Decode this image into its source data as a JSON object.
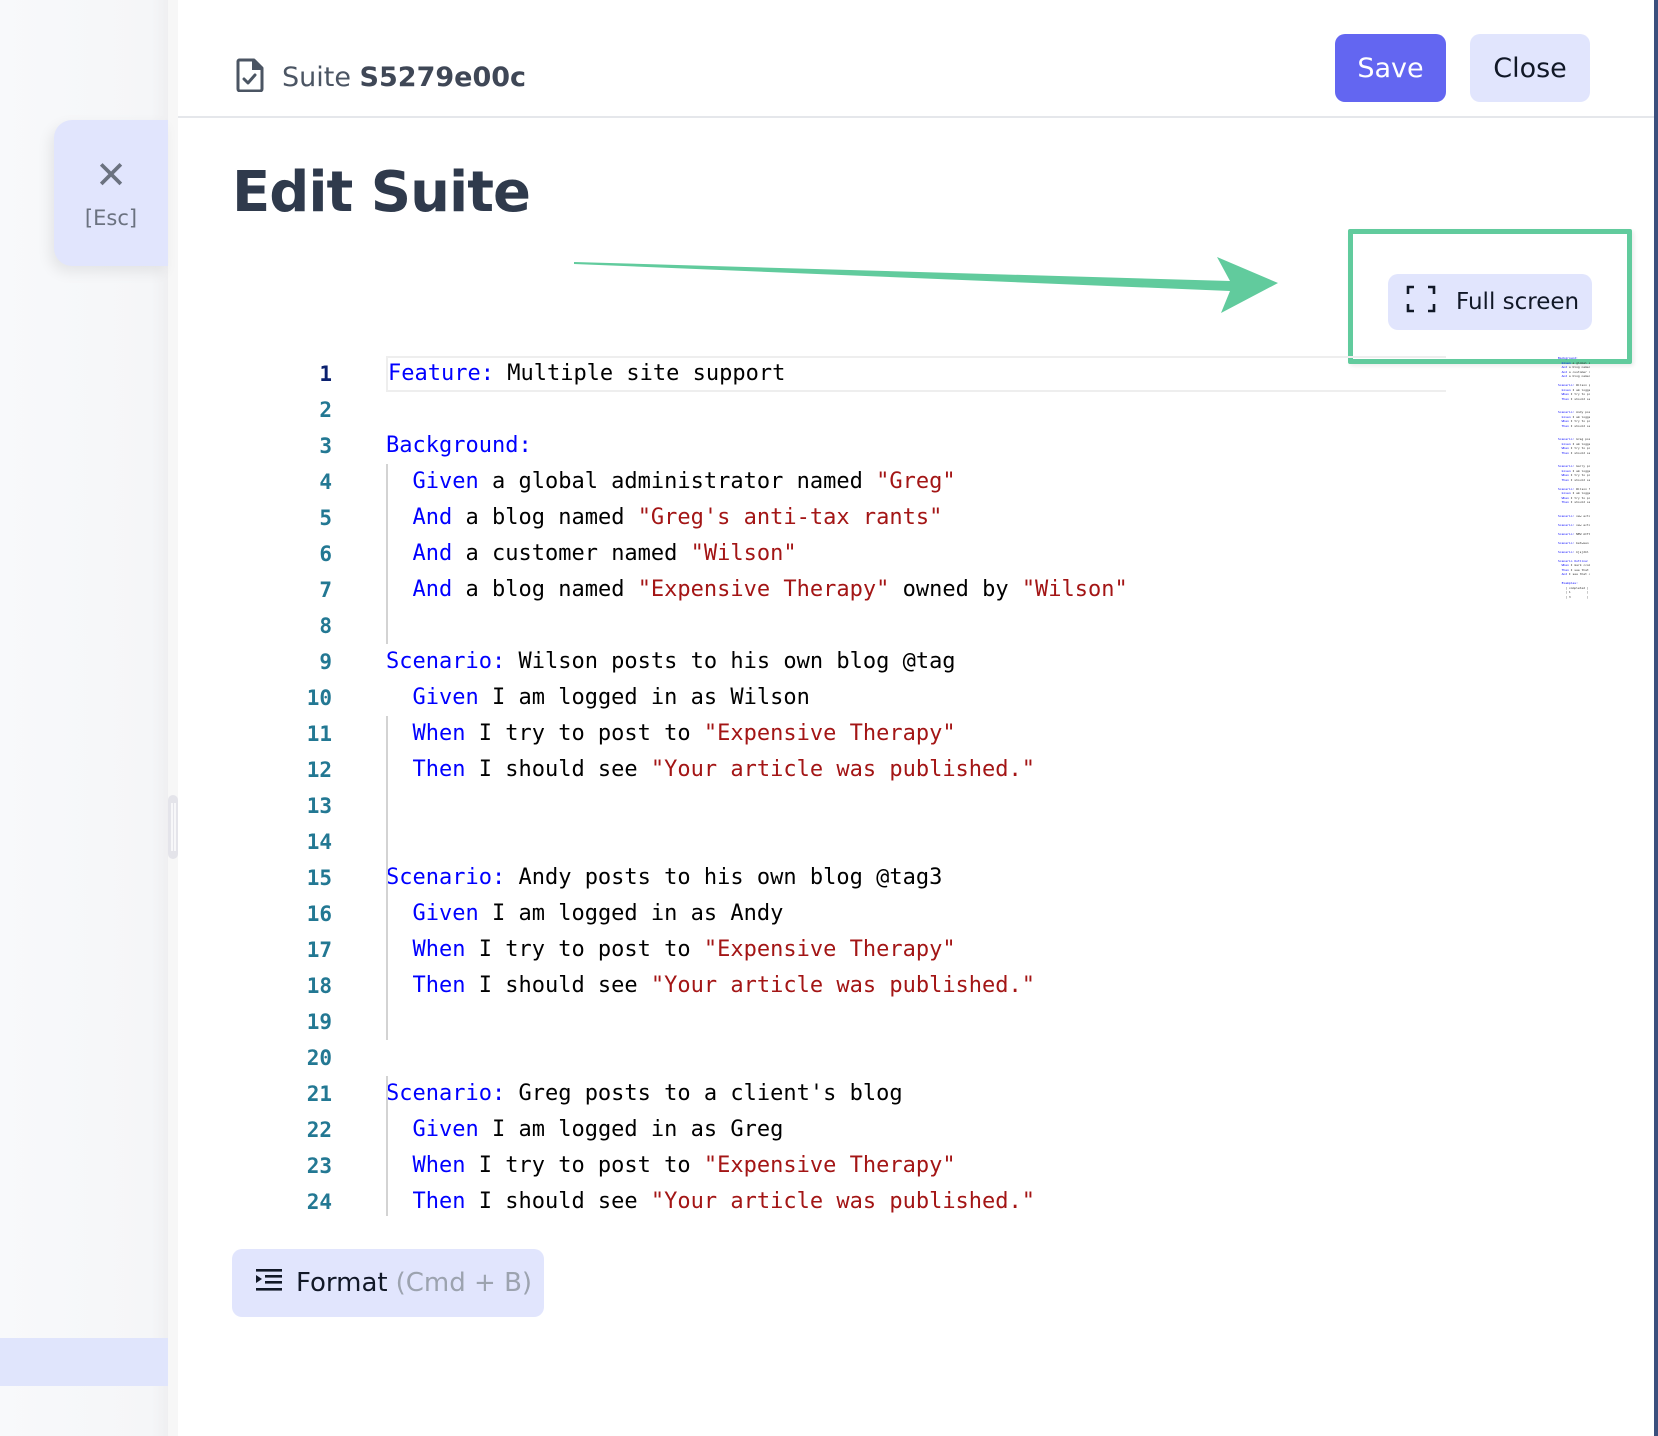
{
  "sidebar": {
    "esc_button": {
      "icon": "close-icon",
      "glyph": "✕",
      "label": "[Esc]"
    }
  },
  "header": {
    "icon": "file-check-icon",
    "prefix": "Suite",
    "suite_id": "S5279e00c",
    "save_label": "Save",
    "close_label": "Close"
  },
  "page": {
    "title": "Edit Suite"
  },
  "toolbar": {
    "fullscreen_label": "Full screen",
    "fullscreen_icon": "expand-icon",
    "format_label": "Format",
    "format_shortcut": "(Cmd + B)",
    "format_icon": "indent-icon"
  },
  "annotation": {
    "color": "#61cb9d",
    "target": "Full screen"
  },
  "colors": {
    "accent": "#6366f1",
    "secondary_button": "#e1e5fd",
    "keyword": "#0000ff",
    "string": "#a31515",
    "line_number": "#237893"
  },
  "editor": {
    "active_line": 1,
    "lines": [
      {
        "n": "1",
        "tokens": [
          [
            "kw",
            "Feature:"
          ],
          [
            "t",
            " Multiple site support"
          ]
        ]
      },
      {
        "n": "2",
        "tokens": []
      },
      {
        "n": "3",
        "tokens": [
          [
            "kw",
            "Background:"
          ]
        ]
      },
      {
        "n": "4",
        "tokens": [
          [
            "t",
            "  "
          ],
          [
            "kw",
            "Given"
          ],
          [
            "t",
            " a global administrator named "
          ],
          [
            "str",
            "\"Greg\""
          ]
        ]
      },
      {
        "n": "5",
        "tokens": [
          [
            "t",
            "  "
          ],
          [
            "kw",
            "And"
          ],
          [
            "t",
            " a blog named "
          ],
          [
            "str",
            "\"Greg's anti-tax rants\""
          ]
        ]
      },
      {
        "n": "6",
        "tokens": [
          [
            "t",
            "  "
          ],
          [
            "kw",
            "And"
          ],
          [
            "t",
            " a customer named "
          ],
          [
            "str",
            "\"Wilson\""
          ]
        ]
      },
      {
        "n": "7",
        "tokens": [
          [
            "t",
            "  "
          ],
          [
            "kw",
            "And"
          ],
          [
            "t",
            " a blog named "
          ],
          [
            "str",
            "\"Expensive Therapy\""
          ],
          [
            "t",
            " owned by "
          ],
          [
            "str",
            "\"Wilson\""
          ]
        ]
      },
      {
        "n": "8",
        "tokens": []
      },
      {
        "n": "9",
        "tokens": [
          [
            "kw",
            "Scenario:"
          ],
          [
            "t",
            " Wilson posts to his own blog @tag"
          ]
        ]
      },
      {
        "n": "10",
        "tokens": [
          [
            "t",
            "  "
          ],
          [
            "kw",
            "Given"
          ],
          [
            "t",
            " I am logged in as Wilson"
          ]
        ]
      },
      {
        "n": "11",
        "tokens": [
          [
            "t",
            "  "
          ],
          [
            "kw",
            "When"
          ],
          [
            "t",
            " I try to post to "
          ],
          [
            "str",
            "\"Expensive Therapy\""
          ]
        ]
      },
      {
        "n": "12",
        "tokens": [
          [
            "t",
            "  "
          ],
          [
            "kw",
            "Then"
          ],
          [
            "t",
            " I should see "
          ],
          [
            "str",
            "\"Your article was published.\""
          ]
        ]
      },
      {
        "n": "13",
        "tokens": []
      },
      {
        "n": "14",
        "tokens": []
      },
      {
        "n": "15",
        "tokens": [
          [
            "kw",
            "Scenario:"
          ],
          [
            "t",
            " Andy posts to his own blog @tag3"
          ]
        ]
      },
      {
        "n": "16",
        "tokens": [
          [
            "t",
            "  "
          ],
          [
            "kw",
            "Given"
          ],
          [
            "t",
            " I am logged in as Andy"
          ]
        ]
      },
      {
        "n": "17",
        "tokens": [
          [
            "t",
            "  "
          ],
          [
            "kw",
            "When"
          ],
          [
            "t",
            " I try to post to "
          ],
          [
            "str",
            "\"Expensive Therapy\""
          ]
        ]
      },
      {
        "n": "18",
        "tokens": [
          [
            "t",
            "  "
          ],
          [
            "kw",
            "Then"
          ],
          [
            "t",
            " I should see "
          ],
          [
            "str",
            "\"Your article was published.\""
          ]
        ]
      },
      {
        "n": "19",
        "tokens": []
      },
      {
        "n": "20",
        "tokens": []
      },
      {
        "n": "21",
        "tokens": [
          [
            "kw",
            "Scenario:"
          ],
          [
            "t",
            " Greg posts to a client's blog"
          ]
        ]
      },
      {
        "n": "22",
        "tokens": [
          [
            "t",
            "  "
          ],
          [
            "kw",
            "Given"
          ],
          [
            "t",
            " I am logged in as Greg"
          ]
        ]
      },
      {
        "n": "23",
        "tokens": [
          [
            "t",
            "  "
          ],
          [
            "kw",
            "When"
          ],
          [
            "t",
            " I try to post to "
          ],
          [
            "str",
            "\"Expensive Therapy\""
          ]
        ]
      },
      {
        "n": "24",
        "tokens": [
          [
            "t",
            "  "
          ],
          [
            "kw",
            "Then"
          ],
          [
            "t",
            " I should see "
          ],
          [
            "str",
            "\"Your article was published.\""
          ]
        ]
      }
    ],
    "minimap_lines": [
      "Background:",
      "  Given a global administrator named \"Greg\"",
      "  And a blog named \"Greg's anti-tax rants\"",
      "  And a customer named \"Wilson\"",
      "  And a blog named \"Expensive Therapy\" owned by \"Wilson\"",
      "",
      "Scenario: Wilson posts to his own blog @tag",
      "  Given I am logged in as Wilson",
      "  When I try to post to \"Expensive Therapy\"",
      "  Then I should see \"Your article was published.\"",
      "",
      "",
      "Scenario: Andy posts to his own blog @tag3",
      "  Given I am logged in as Andy",
      "  When I try to post to \"Expensive Therapy\"",
      "  Then I should see \"Your article was published.\"",
      "",
      "",
      "Scenario: Greg posts to a client's blog",
      "  Given I am logged in as Greg",
      "  When I try to post to \"Expensive Therapy\"",
      "  Then I should see \"Your article was published.\"",
      "",
      "",
      "Scenario: Garry posts to a client's blog",
      "  Given I am logged in as Garry",
      "  When I try to post to \"Expensive Therapy\"",
      "  Then I should see \"Your article was published.\"",
      "",
      "Scenario: Wilson fails to post to somebody else's blog",
      "  Given I am logged in as Wilson",
      "  When I try to post to \"Greg's anti-tax rants\"",
      "  Then I should see \"Hey! That's not your blog!\"",
      "",
      "",
      "Scenario: new actor2",
      "",
      "Scenario: new actor3",
      "",
      "Scenario: NEW ACTOR",
      "",
      "Scenario: between tests",
      "",
      "Scenario: kjsjdkl",
      "",
      "Scenario Outline: Mark todos as completed",
      "  When I mark <completed> todos as completed",
      "  Then I see that <activeTodo> todos are still active",
      "  And I see that <completedTodo> has been completed",
      "",
      "  Examples:",
      "    | completed | activeTodo | completedTodo |",
      "    | 1         | 2          | 3             |",
      "    | 3         | 2          | 3             |"
    ]
  }
}
